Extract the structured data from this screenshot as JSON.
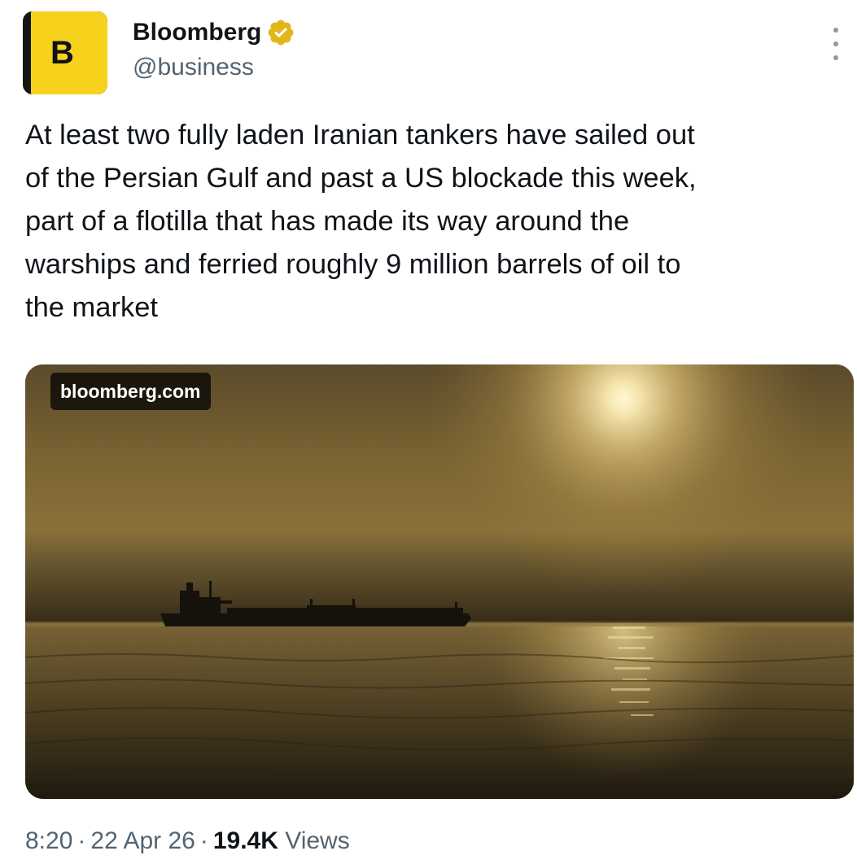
{
  "author": {
    "avatar_letter": "B",
    "display_name": "Bloomberg",
    "handle": "@business",
    "verified": true,
    "badge_color": "#e2b719"
  },
  "tweet": {
    "text": "At least two fully laden Iranian tankers have sailed out\nof the Persian Gulf and past a US blockade this week,\npart of a flotilla that has made its way around the\nwarships and ferried roughly 9 million barrels of oil to\nthe market"
  },
  "media": {
    "link_domain": "bloomberg.com",
    "icon": "tanker-ship-at-sunset-photo"
  },
  "meta": {
    "time": "8:20",
    "separator": "·",
    "date": "22 Apr 26",
    "views_count": "19.4K",
    "views_label": "Views"
  },
  "icons": {
    "more": "more-icon",
    "verified": "verified-badge-icon"
  }
}
